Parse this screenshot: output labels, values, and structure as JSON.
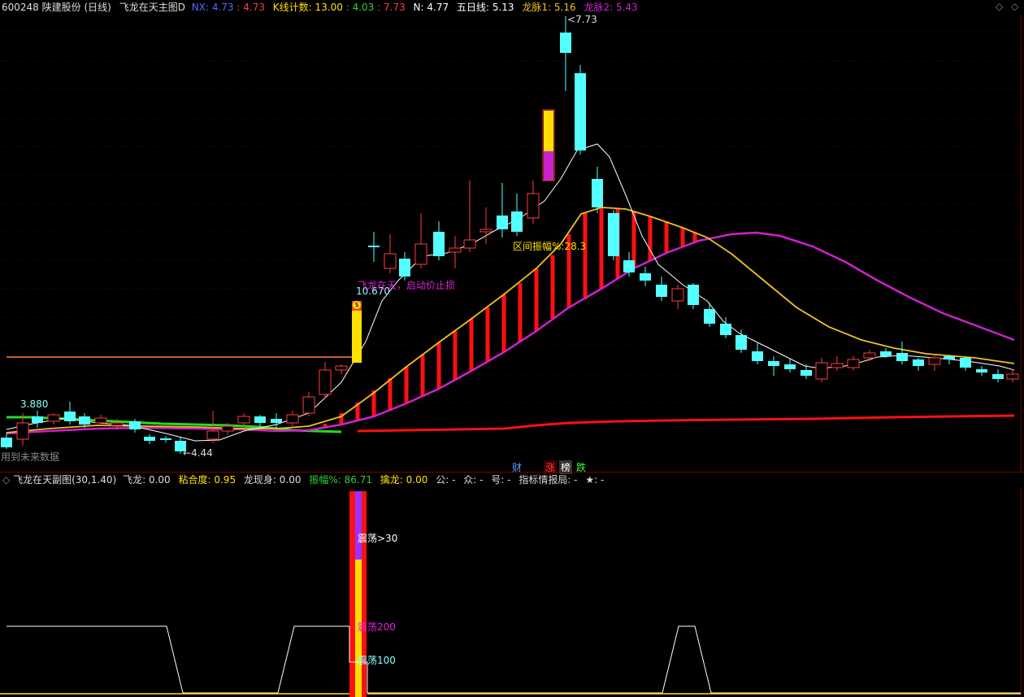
{
  "header": {
    "code": "600248",
    "name": "陕建股份",
    "period": "(日线)",
    "main_indicator": "飞龙在天主图D",
    "nx_label": "NX:",
    "nx_value1": "4.73",
    "nx_value2": "4.73",
    "kcount_label": "K线计数:",
    "kcount_v1": "13.00",
    "kcount_v2": "4.03",
    "kcount_v3": "7.73",
    "n_label": "N:",
    "n_value": "4.77",
    "ma5_label": "五日线:",
    "ma5_value": "5.13",
    "lm1_label": "龙脉1:",
    "lm1_value": "5.16",
    "lm2_label": "龙脉2:",
    "lm2_value": "5.43"
  },
  "controls": {
    "up_icon": "chevron-up-icon",
    "diamond_icon": "diamond-icon",
    "close_icon": "close-icon"
  },
  "main_chart": {
    "price_high_label": "7.73",
    "price_low_label": "4.44",
    "prev_high_label": "3.880",
    "entry_price_label": "10.670",
    "signal_text": "飞龙在天，启动价止损",
    "range_text": "区间振幅%:28.3",
    "future_text": "用到未来数据",
    "badges": [
      "财",
      "涨",
      "榜",
      "跌"
    ],
    "colors": {
      "up": "#ff3b3b",
      "down": "#54ffff",
      "ma5": "#ffffff",
      "lm1": "#f0c020",
      "lm2": "#cc22cc"
    }
  },
  "sub_header": {
    "title": "飞龙在天副图(30,1.40)",
    "fl_label": "飞龙:",
    "fl_value": "0.00",
    "nhd_label": "粘合度:",
    "nhd_value": "0.95",
    "lxs_label": "龙现身:",
    "lxs_value": "0.00",
    "zf_label": "振幅%:",
    "zf_value": "86.71",
    "ql_label": "擒龙:",
    "ql_value": "0.00",
    "gong": "公: -",
    "zhong": "众: -",
    "hao": "号: -",
    "zbqbj": "指标情报局: -",
    "star": "★: -"
  },
  "sub_chart": {
    "label_30": "震荡>30",
    "label_200": "震荡200",
    "label_100": "震荡100"
  }
}
